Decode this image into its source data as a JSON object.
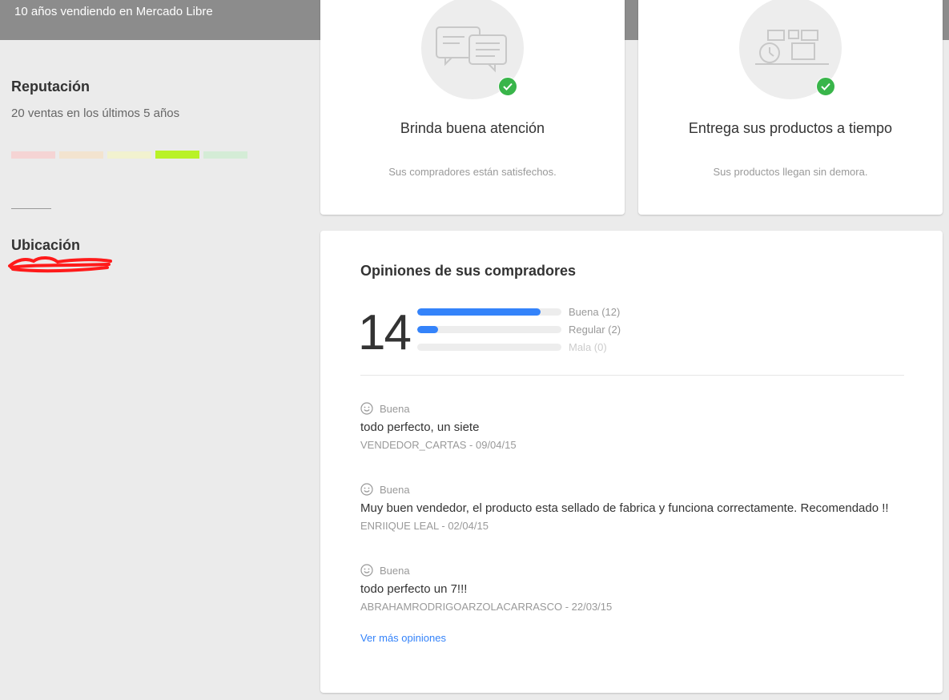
{
  "topbar": {
    "text": "10 años vendiendo en Mercado Libre"
  },
  "sidebar": {
    "reputation_title": "Reputación",
    "reputation_sub": "20 ventas en los últimos 5 años",
    "thermometer": {
      "colors": [
        "#f5d4d4",
        "#f3e3cf",
        "#f2f2cf",
        "#b9f227",
        "#d4ecd6"
      ],
      "active_index": 3
    },
    "location_title": "Ubicación"
  },
  "cards": [
    {
      "title": "Brinda buena atención",
      "subtitle": "Sus compradores están satisfechos.",
      "icon": "chat-bubbles-icon"
    },
    {
      "title": "Entrega sus productos a tiempo",
      "subtitle": "Sus productos llegan sin demora.",
      "icon": "delivery-clock-icon"
    }
  ],
  "opinions": {
    "title": "Opiniones de sus compradores",
    "total": "14",
    "bars": [
      {
        "label": "Buena (12)",
        "fraction": 0.857
      },
      {
        "label": "Regular (2)",
        "fraction": 0.143
      },
      {
        "label": "Mala (0)",
        "fraction": 0
      }
    ],
    "reviews": [
      {
        "rating": "Buena",
        "text": "todo perfecto, un siete",
        "meta": "VENDEDOR_CARTAS - 09/04/15"
      },
      {
        "rating": "Buena",
        "text": "Muy buen vendedor, el producto esta sellado de fabrica y funciona correctamente. Recomendado !!",
        "meta": "ENRIIQUE LEAL - 02/04/15"
      },
      {
        "rating": "Buena",
        "text": "todo perfecto un 7!!!",
        "meta": "ABRAHAMRODRIGOARZOLACARRASCO - 22/03/15"
      }
    ],
    "more_link": "Ver más opiniones"
  },
  "colors": {
    "accent": "#3483fa",
    "check": "#39b54a",
    "topbar": "#8c8c8c"
  }
}
